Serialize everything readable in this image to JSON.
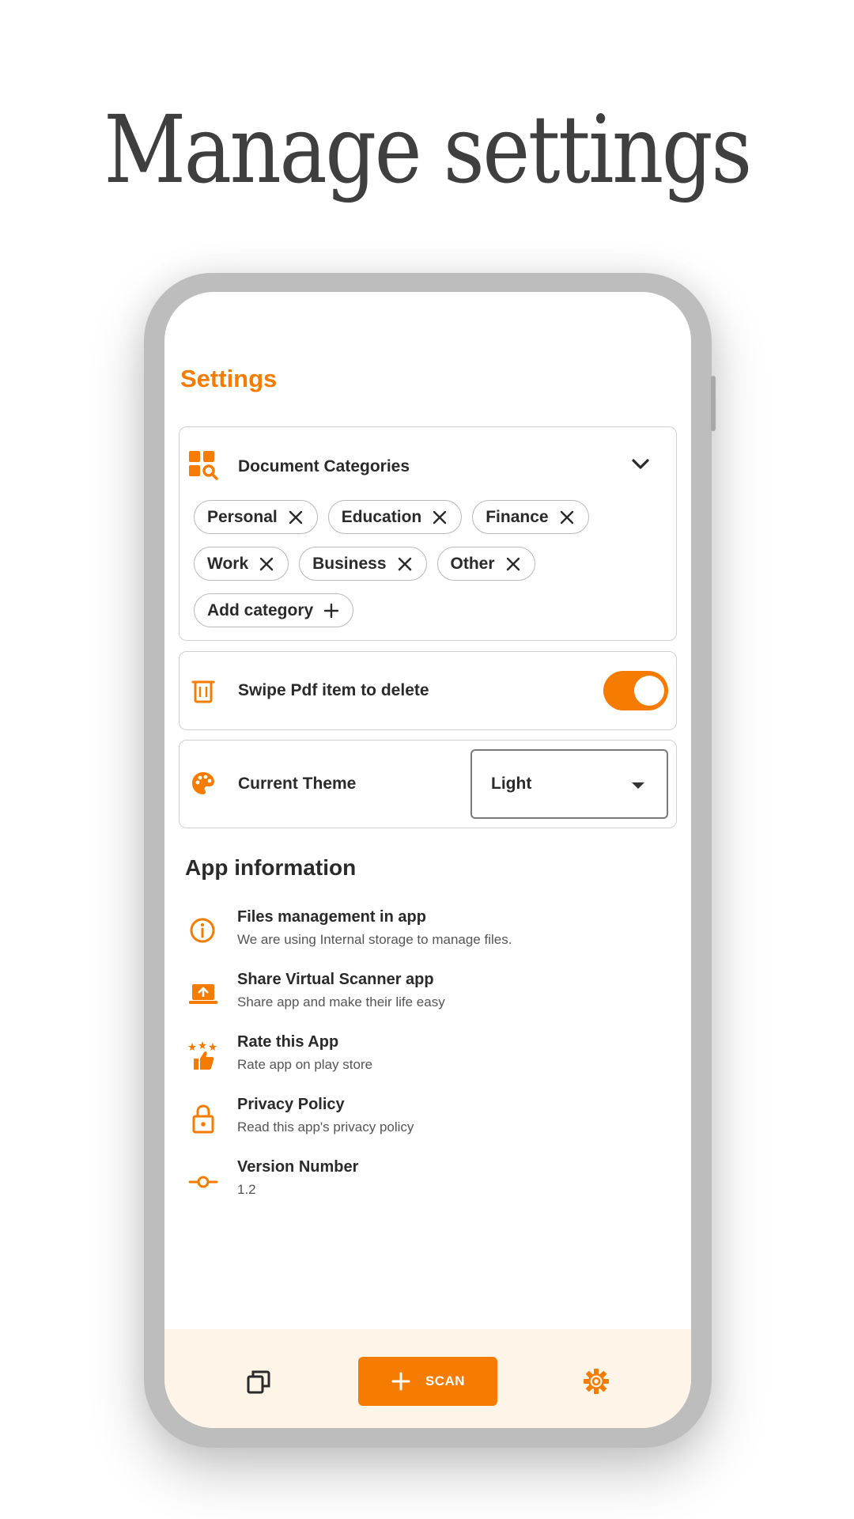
{
  "headline": "Manage settings",
  "colors": {
    "accent": "#f57c00",
    "bottom_bar": "#fff4e8"
  },
  "settings": {
    "title": "Settings",
    "categories": {
      "label": "Document Categories",
      "icon": "category-search-icon",
      "chips_row1": [
        "Personal",
        "Education",
        "Finance"
      ],
      "chips_row2": [
        "Work",
        "Business",
        "Other"
      ],
      "add_label": "Add category"
    },
    "swipe": {
      "label": "Swipe Pdf item to delete",
      "icon": "trash-icon",
      "enabled": true
    },
    "theme": {
      "label": "Current Theme",
      "icon": "palette-icon",
      "value": "Light"
    }
  },
  "app_info": {
    "title": "App information",
    "items": [
      {
        "title": "Files management in app",
        "subtitle": "We are using Internal storage to manage files.",
        "icon": "info-icon"
      },
      {
        "title": "Share Virtual Scanner app",
        "subtitle": "Share app and make their life easy",
        "icon": "share-laptop-icon"
      },
      {
        "title": "Rate this App",
        "subtitle": "Rate app on play store",
        "icon": "rate-thumb-icon"
      },
      {
        "title": "Privacy Policy",
        "subtitle": "Read this app's privacy policy",
        "icon": "lock-icon"
      },
      {
        "title": "Version Number",
        "subtitle": "1.2",
        "icon": "commit-icon"
      }
    ]
  },
  "bottom_nav": {
    "scan_label": "SCAN"
  }
}
